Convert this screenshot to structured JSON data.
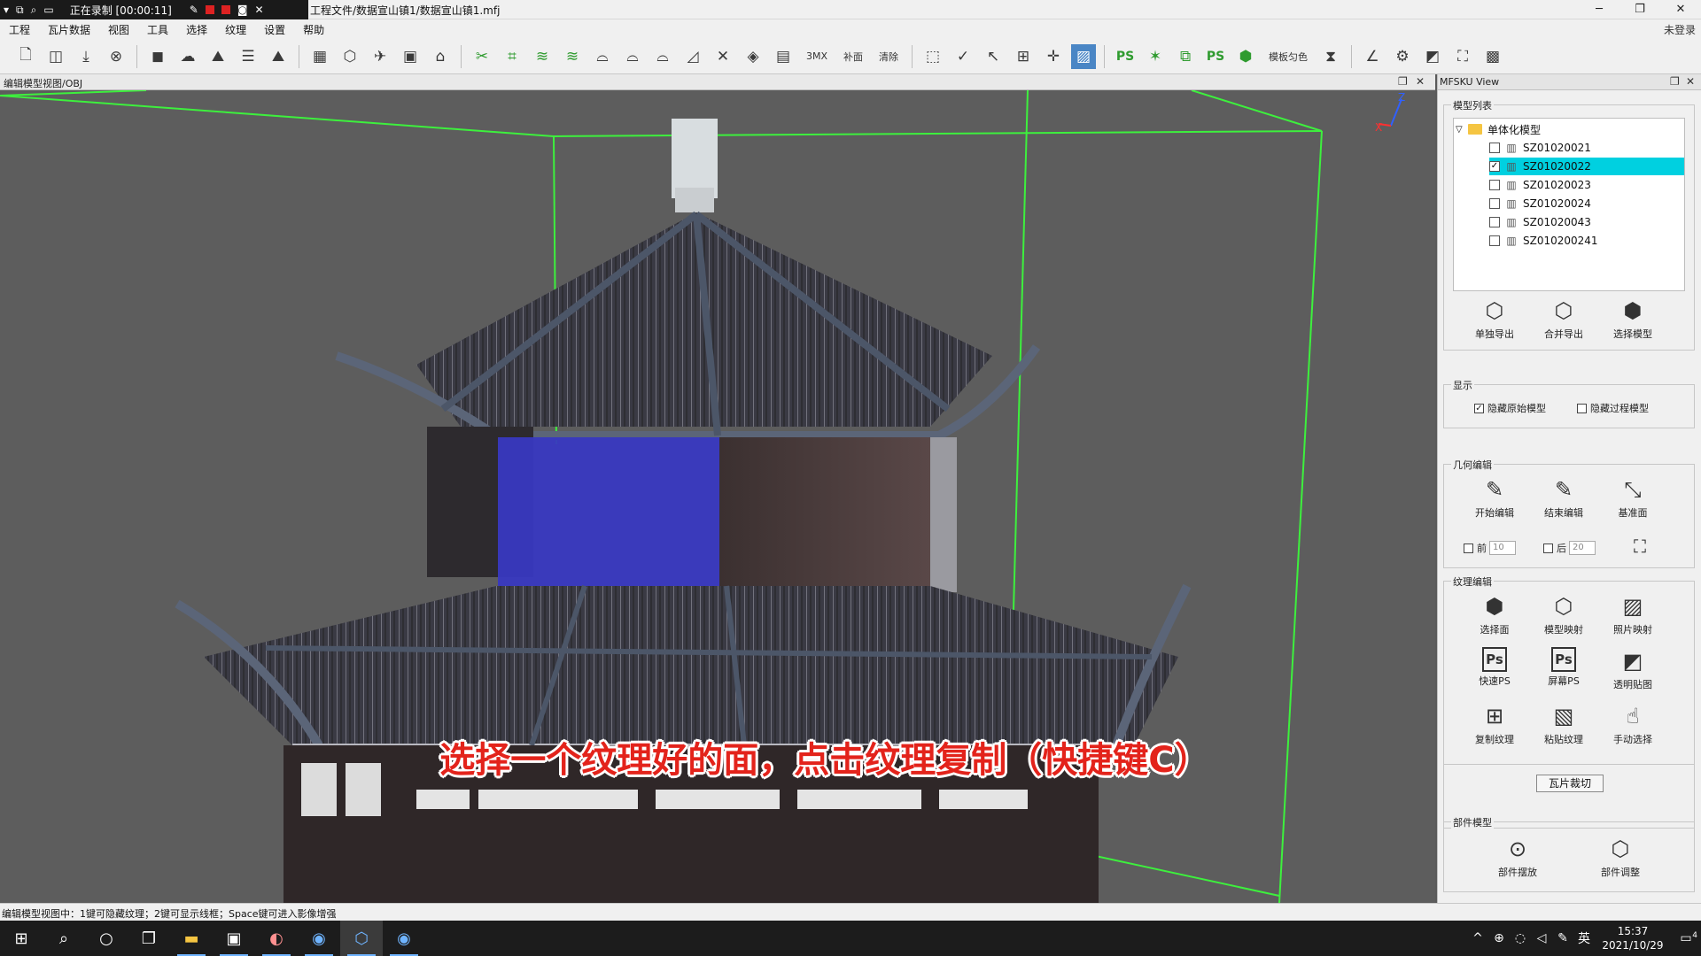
{
  "titlebar": {
    "recording_label": "正在录制 [00:00:11]",
    "title": "工程文件/数据宣山镇1/数据宣山镇1.mfj",
    "minimize": "─",
    "maximize": "❐",
    "close": "✕"
  },
  "menu": [
    "工程",
    "瓦片数据",
    "视图",
    "工具",
    "选择",
    "纹理",
    "设置",
    "帮助"
  ],
  "login_status": "未登录",
  "toolbar": {
    "text_buttons": [
      "3MX",
      "补面",
      "清除",
      "模板匀色"
    ],
    "ps_label": "PS"
  },
  "viewport": {
    "title": "编辑模型视图/OBJ",
    "subtitle": "选择一个纹理好的面，点击纹理复制（快捷键C）",
    "axis_z": "Z",
    "axis_x": "X"
  },
  "panel": {
    "title": "MFSKU View",
    "model_list": {
      "label": "模型列表",
      "root": "单体化模型",
      "items": [
        {
          "name": "SZ01020021",
          "checked": false
        },
        {
          "name": "SZ01020022",
          "checked": true
        },
        {
          "name": "SZ01020023",
          "checked": false
        },
        {
          "name": "SZ01020024",
          "checked": false
        },
        {
          "name": "SZ01020043",
          "checked": false
        },
        {
          "name": "SZ010200241",
          "checked": false
        }
      ],
      "buttons": [
        "单独导出",
        "合并导出",
        "选择模型"
      ]
    },
    "display": {
      "label": "显示",
      "hide_original": "隐藏原始模型",
      "hide_process": "隐藏过程模型"
    },
    "geometry": {
      "label": "几何编辑",
      "buttons": [
        "开始编辑",
        "结束编辑",
        "基准面"
      ],
      "front_label": "前",
      "front_value": "10",
      "back_label": "后",
      "back_value": "20"
    },
    "texture": {
      "label": "纹理编辑",
      "buttons": [
        "选择面",
        "模型映射",
        "照片映射",
        "快速PS",
        "屏幕PS",
        "透明贴图",
        "复制纹理",
        "粘贴纹理",
        "手动选择"
      ]
    },
    "tile_cut": "瓦片裁切",
    "parts": {
      "label": "部件模型",
      "buttons": [
        "部件摆放",
        "部件调整"
      ]
    }
  },
  "statusbar": {
    "text": "编辑模型视图中：1键可隐藏纹理；2键可显示线框；Space键可进入影像增强"
  },
  "taskbar": {
    "time": "15:37",
    "date": "2021/10/29",
    "ime": "英",
    "notification_count": "4"
  }
}
